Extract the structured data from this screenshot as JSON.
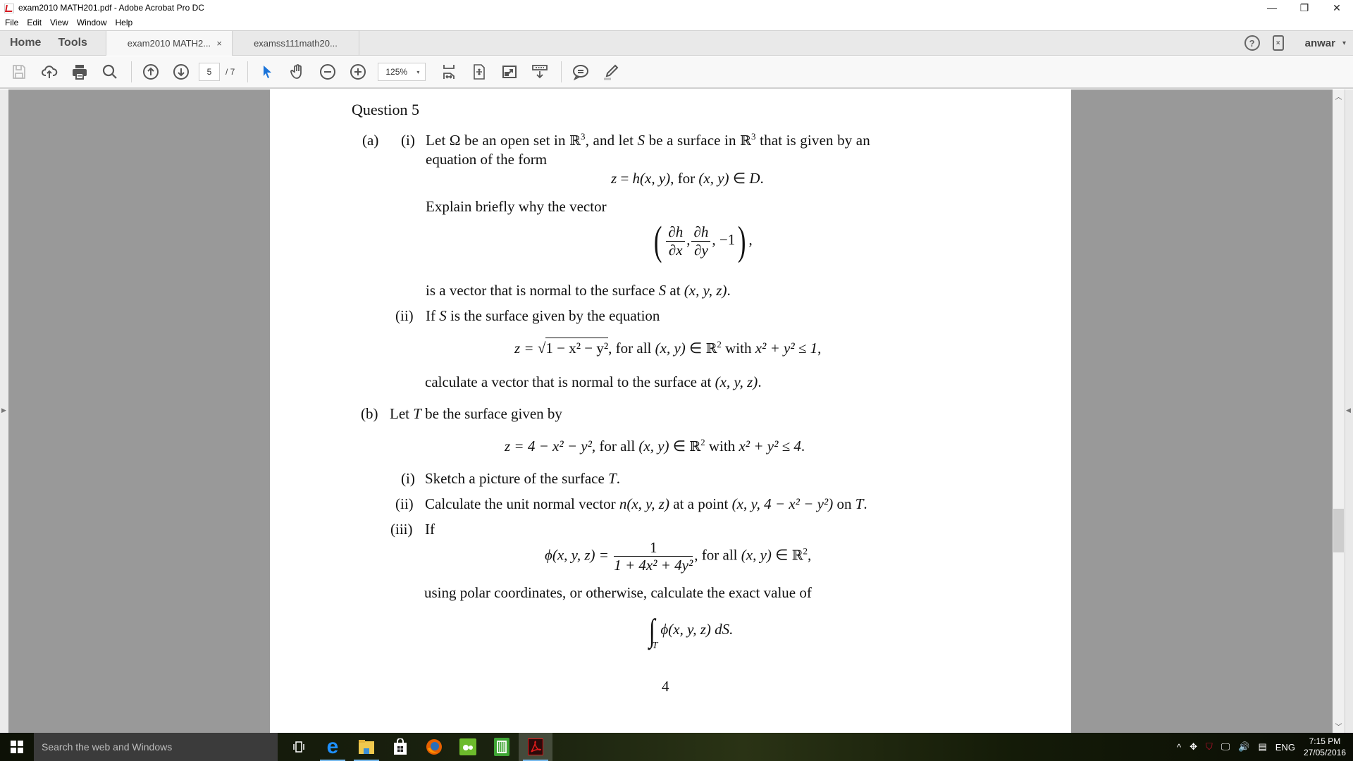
{
  "window": {
    "title": "exam2010 MATH201.pdf - Adobe Acrobat Pro DC",
    "controls": {
      "minimize": "—",
      "restore": "❐",
      "close": "✕"
    }
  },
  "menu": [
    "File",
    "Edit",
    "View",
    "Window",
    "Help"
  ],
  "nav_tabs": [
    "Home",
    "Tools"
  ],
  "doc_tabs": [
    {
      "label": "exam2010 MATH2...",
      "active": true,
      "close": "×"
    },
    {
      "label": "examss111math20...",
      "active": false
    }
  ],
  "account": {
    "help": "?",
    "mobile": "×",
    "user": "anwar",
    "caret": "▾"
  },
  "toolbar": {
    "icons": [
      "save-icon",
      "upload-cloud-icon",
      "print-icon",
      "search-icon",
      "previous-page-icon",
      "next-page-icon",
      "select-arrow-icon",
      "hand-tool-icon",
      "zoom-out-icon",
      "zoom-in-icon",
      "scroll-mode-icon",
      "fit-page-icon",
      "full-screen-icon",
      "read-mode-icon",
      "comment-icon",
      "highlight-pen-icon"
    ],
    "page_current": "5",
    "page_total": "/ 7",
    "zoom": "125%",
    "zoom_caret": "▾"
  },
  "document": {
    "heading": "Question 5",
    "a_label": "(a)",
    "a_i_label": "(i)",
    "a_i_line1": [
      "Let ",
      "Ω",
      " be an open set in ",
      "ℝ",
      "3",
      ", and let ",
      "S",
      " be a surface in ",
      "ℝ",
      "3",
      " that is given by an"
    ],
    "a_i_line2": "equation of the form",
    "eq1": {
      "lhs": "z",
      "eq": " = ",
      "h": "h",
      "args": "(x, y)",
      "for": ", for ",
      "dom": "(x, y)",
      "in": " ∈ ",
      "D": "D",
      "end": "."
    },
    "explain": "Explain briefly why the vector",
    "vector": {
      "num1": "∂h",
      "den1": "∂x",
      "num2": "∂h",
      "den2": "∂y",
      "last": "−1",
      "lparen": "(",
      "rparen": ")",
      "sep": ",",
      "trail": ","
    },
    "normal_text": [
      "is a vector that is normal to the surface ",
      "S",
      " at ",
      "(x, y, z)",
      "."
    ],
    "a_ii_label": "(ii)",
    "a_ii_text": [
      "If ",
      "S",
      " is the surface given by the equation"
    ],
    "eq2": {
      "lhs": "z = ",
      "sqrt": "1 − x² − y²",
      "rest1": ", for all ",
      "xy": "(x, y)",
      "in": " ∈ ",
      "R": "ℝ",
      "sup": "2",
      "with": " with ",
      "cond": "x² + y² ≤ 1",
      "end": ","
    },
    "calc_text": [
      "calculate a vector that is normal to the surface at ",
      "(x, y, z)",
      "."
    ],
    "b_label": "(b)",
    "b_text": [
      "Let ",
      "T",
      " be the surface given by"
    ],
    "eq3": {
      "lhs": "z = 4 − x² − y²",
      "rest1": ", for all ",
      "xy": "(x, y)",
      "in": " ∈ ",
      "R": "ℝ",
      "sup": "2",
      "with": " with ",
      "cond": "x² + y² ≤ 4",
      "end": "."
    },
    "b_i_label": "(i)",
    "b_i_text": [
      "Sketch a picture of the surface ",
      "T",
      "."
    ],
    "b_ii_label": "(ii)",
    "b_ii_text": [
      "Calculate the unit normal vector ",
      "n(x, y, z)",
      " at a point ",
      "(x, y, 4 − x² − y²)",
      " on ",
      "T",
      "."
    ],
    "b_iii_label": "(iii)",
    "b_iii_text": "If",
    "eq4": {
      "lhs": "ϕ(x, y, z) = ",
      "num": "1",
      "den": "1 + 4x² + 4y²",
      "rest1": ", for all ",
      "xy": "(x, y)",
      "in": " ∈ ",
      "R": "ℝ",
      "sup": "2",
      "end": ","
    },
    "polar_text": "using polar coordinates, or otherwise, calculate the exact value of",
    "integral": {
      "sign": "∫",
      "sub": "T",
      "body": "ϕ(x, y, z) dS."
    },
    "page_number": "4"
  },
  "taskbar": {
    "search_placeholder": "Search the web and Windows",
    "apps": [
      "task-view-icon",
      "edge-icon",
      "file-explorer-icon",
      "store-icon",
      "firefox-icon",
      "green-app-icon",
      "green-sheet-icon",
      "acrobat-icon"
    ],
    "tray": {
      "chevron": "^",
      "lang": "ENG",
      "time": "7:15 PM",
      "date": "27/05/2016"
    }
  }
}
